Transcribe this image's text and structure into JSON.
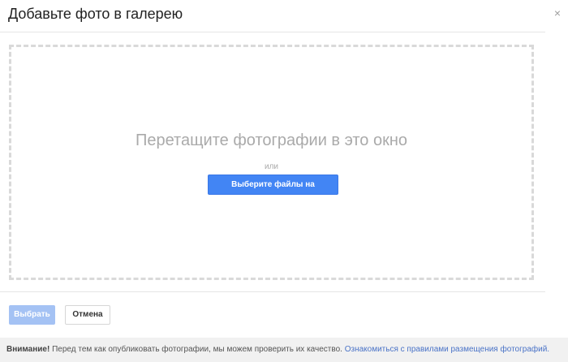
{
  "dialog": {
    "title": "Добавьте фото в галерею",
    "close_glyph": "×"
  },
  "dropzone": {
    "drag_text": "Перетащите фотографии в это окно",
    "or_text": "или",
    "choose_button_label": "Выберите файлы на компьютере"
  },
  "actions": {
    "select_label": "Выбрать",
    "cancel_label": "Отмена"
  },
  "footer": {
    "warning_label": "Внимание!",
    "warning_text": " Перед тем как опубликовать фотографии, мы можем проверить их качество. ",
    "link_text": "Ознакомиться с правилами размещения фотографий."
  },
  "colors": {
    "primary": "#4285f4",
    "primary_disabled": "#a4c2f4",
    "link": "#4a73c7"
  }
}
